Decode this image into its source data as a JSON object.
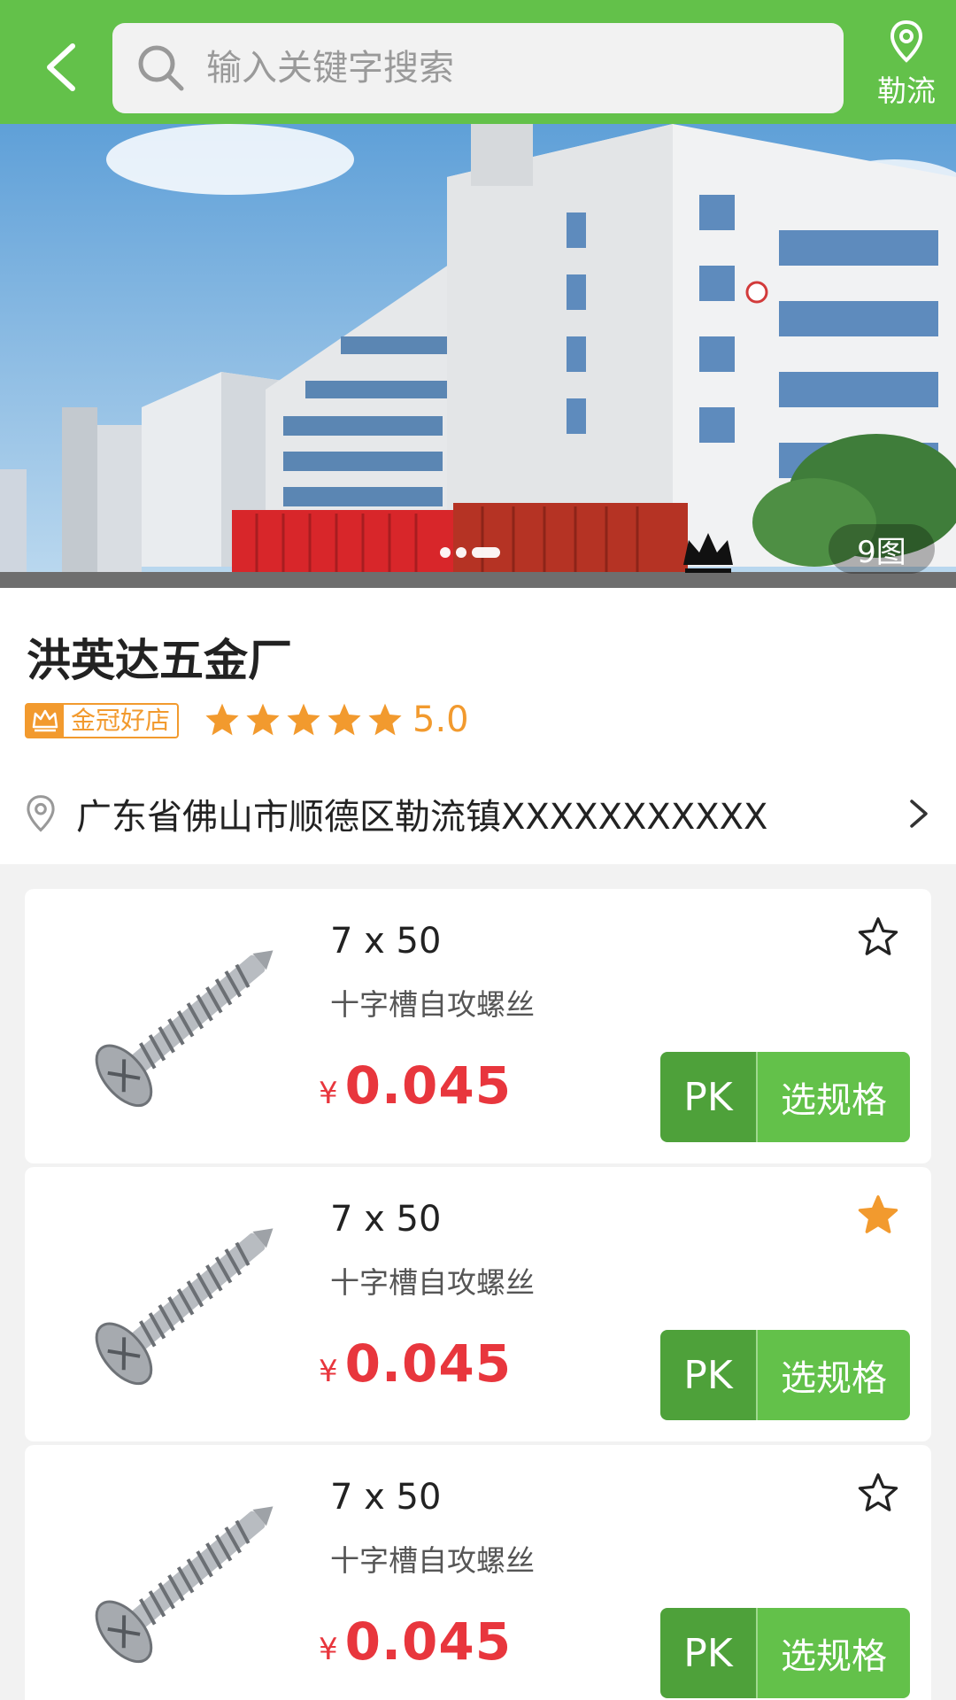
{
  "header": {
    "search_placeholder": "输入关键字搜索",
    "location_label": "勒流"
  },
  "banner": {
    "image_count_label": "9图",
    "slide_count": 3,
    "active_slide": 3
  },
  "shop": {
    "name": "洪英达五金厂",
    "badge_label": "金冠好店",
    "rating_stars": 5,
    "rating_score": "5.0",
    "address": "广东省佛山市顺德区勒流镇XXXXXXXXXXX"
  },
  "products": [
    {
      "title": "7 x 50",
      "subtitle": "十字槽自攻螺丝",
      "currency": "¥",
      "price": "0.045",
      "favorited": false,
      "pk_label": "PK",
      "spec_label": "选规格"
    },
    {
      "title": "7 x 50",
      "subtitle": "十字槽自攻螺丝",
      "currency": "¥",
      "price": "0.045",
      "favorited": true,
      "pk_label": "PK",
      "spec_label": "选规格"
    },
    {
      "title": "7 x 50",
      "subtitle": "十字槽自攻螺丝",
      "currency": "¥",
      "price": "0.045",
      "favorited": false,
      "pk_label": "PK",
      "spec_label": "选规格"
    }
  ],
  "colors": {
    "brand_green": "#63c14a",
    "pk_green": "#4ea13a",
    "price_red": "#e8363d",
    "gold": "#f29a2e"
  },
  "icons": [
    "back-icon",
    "search-icon",
    "location-pin-icon",
    "crown-icon",
    "star-icon",
    "chevron-right-icon",
    "screw-image"
  ]
}
